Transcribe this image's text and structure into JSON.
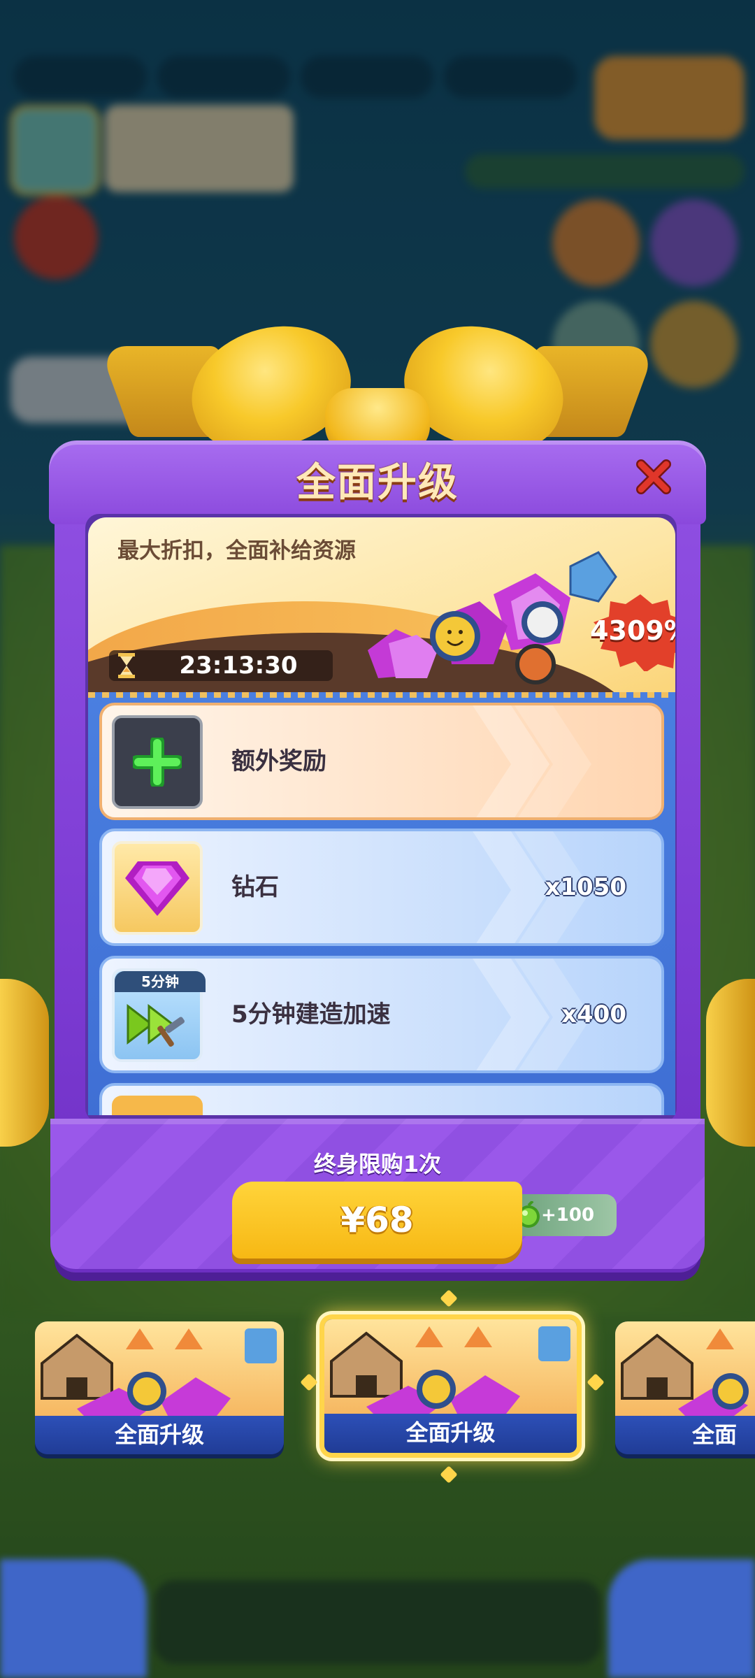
{
  "popup": {
    "title": "全面升级",
    "subtitle": "最大折扣，全面补给资源",
    "timer": "23:13:30",
    "discount_badge": "4309%"
  },
  "rewards": [
    {
      "label": "额外奖励",
      "qty": "",
      "icon": "plus-icon"
    },
    {
      "label": "钻石",
      "qty": "x1050",
      "icon": "diamond-icon"
    },
    {
      "label": "5分钟建造加速",
      "qty": "x400",
      "icon": "build-speedup-icon",
      "tag": "5分钟"
    }
  ],
  "purchase": {
    "limit_text": "终身限购1次",
    "price": "¥68",
    "bonus": "+100"
  },
  "carousel": [
    {
      "label": "全面升级",
      "selected": false
    },
    {
      "label": "全面升级",
      "selected": true
    },
    {
      "label": "全面升"
    }
  ],
  "colors": {
    "accent": "#8f4fe2",
    "buy_button": "#f7b814",
    "title_text": "#ffe9b8"
  }
}
